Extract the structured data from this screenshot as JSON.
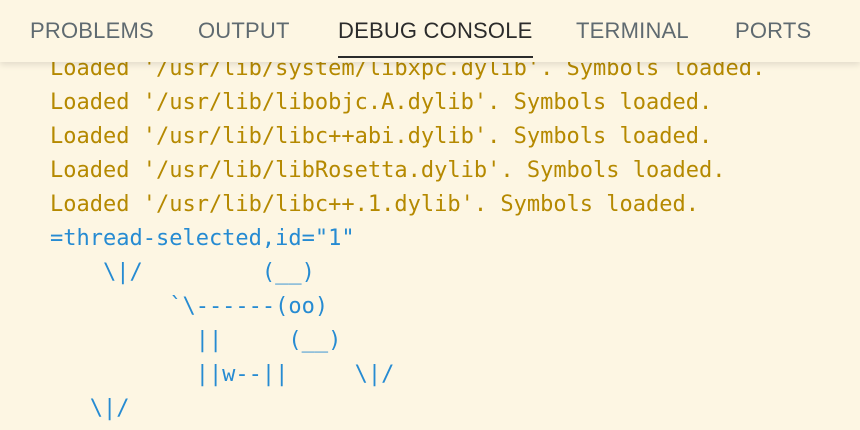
{
  "tabs": [
    {
      "label": "PROBLEMS"
    },
    {
      "label": "OUTPUT"
    },
    {
      "label": "DEBUG CONSOLE"
    },
    {
      "label": "TERMINAL"
    },
    {
      "label": "PORTS"
    }
  ],
  "active_tab": "DEBUG CONSOLE",
  "console": {
    "lines": [
      "Loaded '/usr/lib/system/libxpc.dylib'. Symbols loaded.",
      "Loaded '/usr/lib/libobjc.A.dylib'. Symbols loaded.",
      "Loaded '/usr/lib/libc++abi.dylib'. Symbols loaded.",
      "Loaded '/usr/lib/libRosetta.dylib'. Symbols loaded.",
      "Loaded '/usr/lib/libc++.1.dylib'. Symbols loaded.",
      "=thread-selected,id=\"1\"",
      "    \\|/         (__)",
      "         `\\------(oo)",
      "           ||     (__)",
      "           ||w--||     \\|/",
      "   \\|/"
    ]
  },
  "colors": {
    "background": "#fdf6e3",
    "loaded_text": "#b58900",
    "thread_text": "#268bd2",
    "tab_text": "#5f6a70",
    "active_tab_text": "#2b2b2b"
  }
}
